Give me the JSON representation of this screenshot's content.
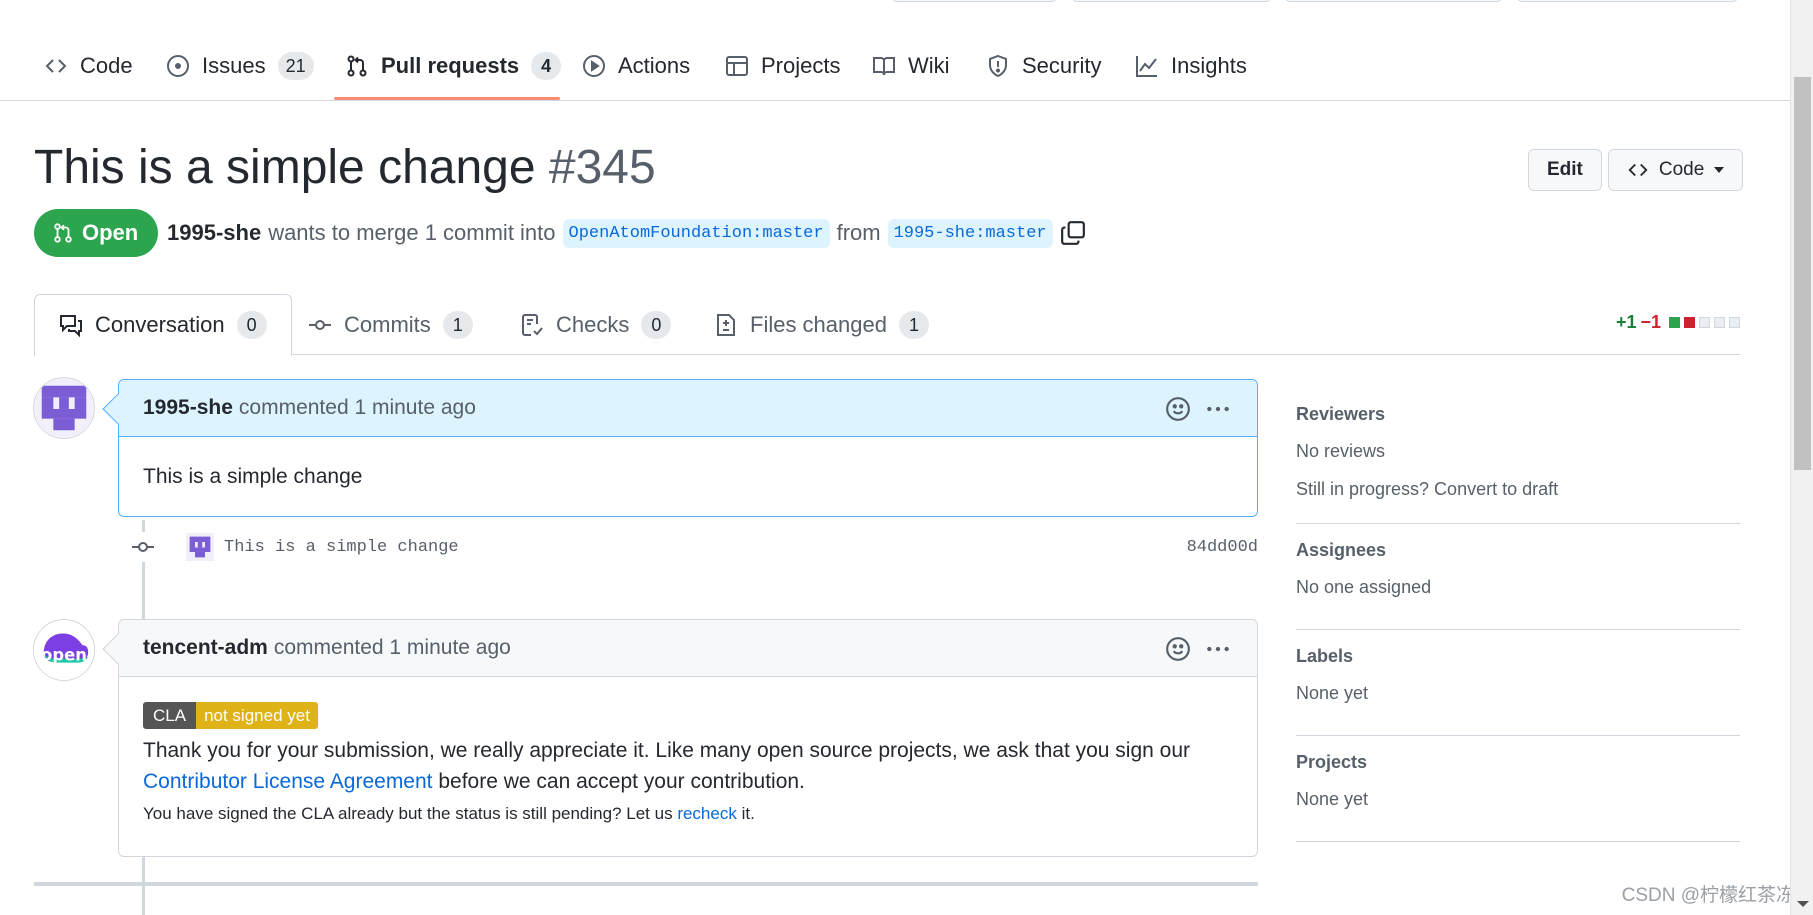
{
  "repo_nav": {
    "items": [
      {
        "label": "Code"
      },
      {
        "label": "Issues",
        "count": "21"
      },
      {
        "label": "Pull requests",
        "count": "4"
      },
      {
        "label": "Actions"
      },
      {
        "label": "Projects"
      },
      {
        "label": "Wiki"
      },
      {
        "label": "Security"
      },
      {
        "label": "Insights"
      }
    ]
  },
  "pr": {
    "title": "This is a simple change",
    "number": "#345",
    "state": "Open",
    "author": "1995-she",
    "merge_text": "wants to merge 1 commit into",
    "base_branch": "OpenAtomFoundation:master",
    "from_text": "from",
    "head_branch": "1995-she:master",
    "edit_label": "Edit",
    "code_label": "Code"
  },
  "tabs": [
    {
      "label": "Conversation",
      "count": "0"
    },
    {
      "label": "Commits",
      "count": "1"
    },
    {
      "label": "Checks",
      "count": "0"
    },
    {
      "label": "Files changed",
      "count": "1"
    }
  ],
  "diffstat": {
    "additions": "+1",
    "deletions": "−1"
  },
  "comments": [
    {
      "author": "1995-she",
      "meta": "commented 1 minute ago",
      "body": "This is a simple change"
    },
    {
      "author": "tencent-adm",
      "meta": "commented 1 minute ago",
      "avatar_text": "open",
      "cla_label": "CLA",
      "cla_status": "not signed yet",
      "body_text": "Thank you for your submission, we really appreciate it. Like many open source projects, we ask that you sign our",
      "body_link": "Contributor License Agreement",
      "body_text_end": "before we can accept your contribution.",
      "note_text": "You have signed the CLA already but the status is still pending? Let us",
      "note_link": "recheck",
      "note_end": "it."
    }
  ],
  "commit": {
    "message": "This is a simple change",
    "sha": "84dd00d"
  },
  "sidebar": {
    "reviewers": {
      "heading": "Reviewers",
      "text": "No reviews",
      "extra": "Still in progress? Convert to draft"
    },
    "assignees": {
      "heading": "Assignees",
      "text": "No one assigned"
    },
    "labels": {
      "heading": "Labels",
      "text": "None yet"
    },
    "projects": {
      "heading": "Projects",
      "text": "None yet"
    }
  },
  "watermark": "CSDN @柠檬红茶冻",
  "colors": {
    "open_green": "#2da44e",
    "link_blue": "#0969da",
    "nav_underline": "#fd8c73",
    "cla_yellow": "#dfb317"
  }
}
